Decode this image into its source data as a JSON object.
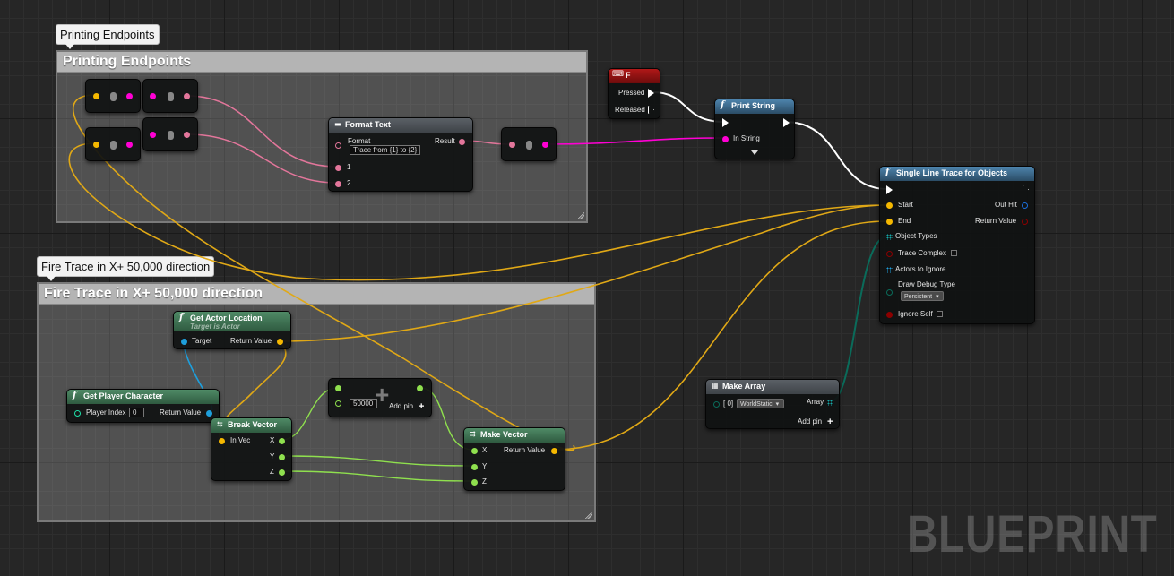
{
  "comments": {
    "printing": {
      "bubble": "Printing Endpoints",
      "title": "Printing Endpoints"
    },
    "fire": {
      "bubble": "Fire Trace in X+ 50,000 direction",
      "title": "Fire Trace in X+ 50,000 direction"
    }
  },
  "nodes": {
    "format_text": {
      "title": "Format Text",
      "format_label": "Format",
      "format_value": "Trace from {1} to {2}",
      "result_label": "Result",
      "pin_1": "1",
      "pin_2": "2"
    },
    "key_f": {
      "title": "F",
      "pressed": "Pressed",
      "released": "Released"
    },
    "print_string": {
      "title": "Print String",
      "in_string": "In String"
    },
    "line_trace": {
      "title": "Single Line Trace for Objects",
      "start": "Start",
      "end": "End",
      "out_hit": "Out Hit",
      "return_value": "Return Value",
      "object_types": "Object Types",
      "trace_complex": "Trace Complex",
      "actors_to_ignore": "Actors to Ignore",
      "draw_debug_type": "Draw Debug Type",
      "draw_debug_value": "Persistent",
      "ignore_self": "Ignore Self"
    },
    "get_actor_location": {
      "title": "Get Actor Location",
      "subtitle": "Target is Actor",
      "target": "Target",
      "return_value": "Return Value"
    },
    "get_player_character": {
      "title": "Get Player Character",
      "player_index": "Player Index",
      "player_index_value": "0",
      "return_value": "Return Value"
    },
    "break_vector": {
      "title": "Break Vector",
      "in_vec": "In Vec",
      "x": "X",
      "y": "Y",
      "z": "Z"
    },
    "add": {
      "value": "50000",
      "add_pin": "Add pin"
    },
    "make_vector": {
      "title": "Make Vector",
      "x": "X",
      "y": "Y",
      "z": "Z",
      "return_value": "Return Value"
    },
    "make_array": {
      "title": "Make Array",
      "index0": "[ 0]",
      "index0_value": "WorldStatic",
      "array": "Array",
      "add_pin": "Add pin"
    }
  },
  "watermark": "BLUEPRINT",
  "colors": {
    "vector_pin": "#f5b800",
    "text_pin": "#e3769b",
    "string_pin": "#ff00d4",
    "float_pin": "#8fe04e",
    "object_pin": "#1e9fdc",
    "struct_pin": "#1b6fdc",
    "int_pin": "#1ee0a8",
    "enum_pin": "#0a6b5a",
    "bool_pin": "#8c0000",
    "key_header": "#8a1010",
    "function_header": "#3d6a8c",
    "pure_header": "#3c6b4e",
    "macro_header": "#5a6066"
  }
}
